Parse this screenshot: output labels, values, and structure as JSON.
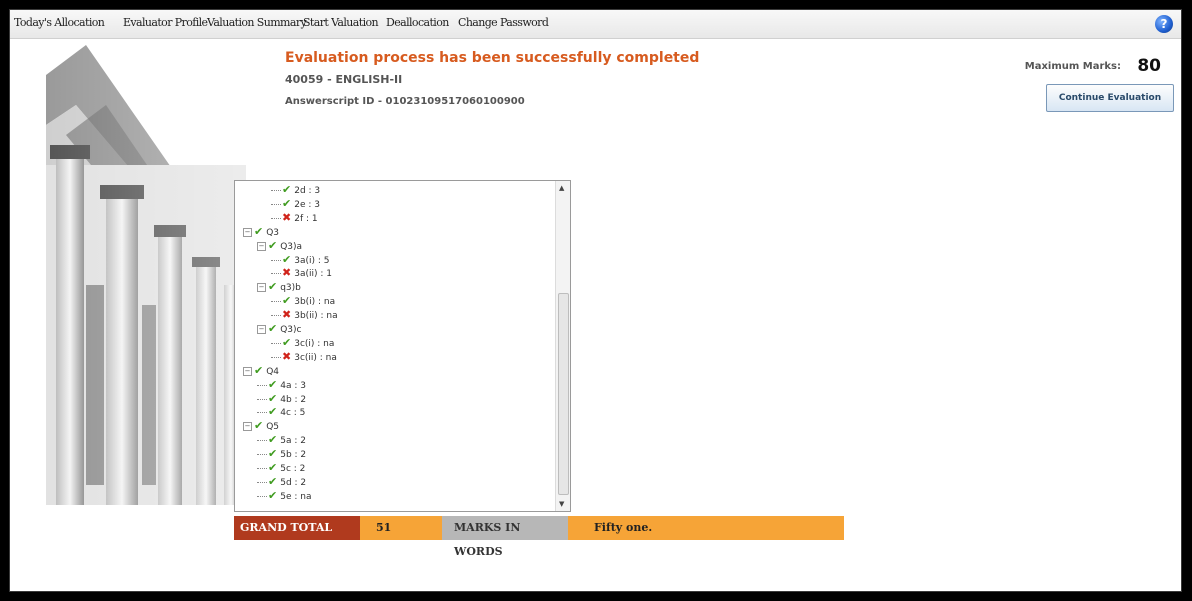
{
  "nav": {
    "items": [
      "Today's Allocation",
      "Evaluator Profile",
      "Valuation Summary",
      "Start Valuation",
      "Deallocation",
      "Change Password"
    ],
    "help_icon": "help-icon"
  },
  "header": {
    "status": "Evaluation process has been successfully completed",
    "subject": "40059 - ENGLISH-II",
    "answerscript": "Answerscript ID - 01023109517060100900",
    "max_marks_label": "Maximum Marks:",
    "max_marks_value": "80",
    "continue_button": "Continue Evaluation"
  },
  "tree": {
    "rows": [
      {
        "label": "2d : 3",
        "status": "ok",
        "level": 2,
        "expander": false
      },
      {
        "label": "2e : 3",
        "status": "ok",
        "level": 2,
        "expander": false
      },
      {
        "label": "2f : 1",
        "status": "bad",
        "level": 2,
        "expander": false
      },
      {
        "label": "Q3",
        "status": "ok",
        "level": 0,
        "expander": true
      },
      {
        "label": "Q3)a",
        "status": "ok",
        "level": 1,
        "expander": true
      },
      {
        "label": "3a(i) : 5",
        "status": "ok",
        "level": 2,
        "expander": false
      },
      {
        "label": "3a(ii) : 1",
        "status": "bad",
        "level": 2,
        "expander": false
      },
      {
        "label": "q3)b",
        "status": "ok",
        "level": 1,
        "expander": true
      },
      {
        "label": "3b(i) : na",
        "status": "ok",
        "level": 2,
        "expander": false
      },
      {
        "label": "3b(ii) : na",
        "status": "bad",
        "level": 2,
        "expander": false
      },
      {
        "label": "Q3)c",
        "status": "ok",
        "level": 1,
        "expander": true
      },
      {
        "label": "3c(i) : na",
        "status": "ok",
        "level": 2,
        "expander": false
      },
      {
        "label": "3c(ii) : na",
        "status": "bad",
        "level": 2,
        "expander": false
      },
      {
        "label": "Q4",
        "status": "ok",
        "level": 0,
        "expander": true
      },
      {
        "label": "4a : 3",
        "status": "ok",
        "level": 1,
        "expander": false
      },
      {
        "label": "4b : 2",
        "status": "ok",
        "level": 1,
        "expander": false
      },
      {
        "label": "4c : 5",
        "status": "ok",
        "level": 1,
        "expander": false
      },
      {
        "label": "Q5",
        "status": "ok",
        "level": 0,
        "expander": true
      },
      {
        "label": "5a : 2",
        "status": "ok",
        "level": 1,
        "expander": false
      },
      {
        "label": "5b : 2",
        "status": "ok",
        "level": 1,
        "expander": false
      },
      {
        "label": "5c : 2",
        "status": "ok",
        "level": 1,
        "expander": false
      },
      {
        "label": "5d : 2",
        "status": "ok",
        "level": 1,
        "expander": false
      },
      {
        "label": "5e : na",
        "status": "ok",
        "level": 1,
        "expander": false
      }
    ]
  },
  "totals": {
    "grand_total_label": "GRAND TOTAL",
    "grand_total_value": "51",
    "marks_in_words_label": "MARKS IN WORDS",
    "marks_in_words_value": "Fifty one."
  },
  "colors": {
    "status_title": "#d75b1f",
    "grand_total_bg": "#b03a1e",
    "highlight_bg": "#f6a437",
    "ok": "#3f9b1f",
    "bad": "#d0241b"
  }
}
